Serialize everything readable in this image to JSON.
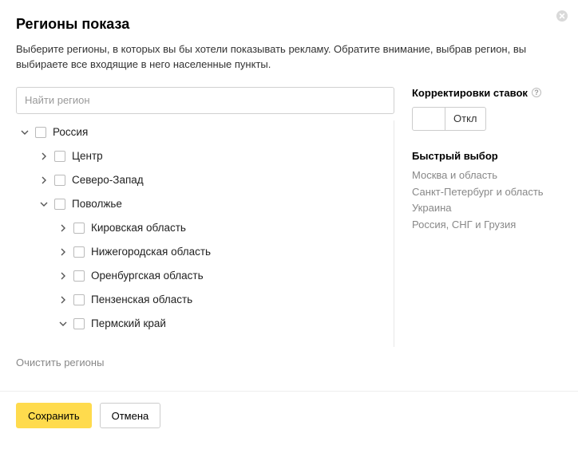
{
  "header": {
    "title": "Регионы показа",
    "description": "Выберите регионы, в которых вы бы хотели показывать рекламу. Обратите внимание, выбрав регион, вы выбираете все входящие в него населенные пункты."
  },
  "search": {
    "placeholder": "Найти регион"
  },
  "tree": [
    {
      "label": "Россия",
      "depth": 0,
      "expanded": true
    },
    {
      "label": "Центр",
      "depth": 1,
      "expanded": false
    },
    {
      "label": "Северо-Запад",
      "depth": 1,
      "expanded": false
    },
    {
      "label": "Поволжье",
      "depth": 1,
      "expanded": true
    },
    {
      "label": "Кировская область",
      "depth": 2,
      "expanded": false
    },
    {
      "label": "Нижегородская область",
      "depth": 2,
      "expanded": false
    },
    {
      "label": "Оренбургская область",
      "depth": 2,
      "expanded": false
    },
    {
      "label": "Пензенская область",
      "depth": 2,
      "expanded": false
    },
    {
      "label": "Пермский край",
      "depth": 2,
      "expanded": true
    }
  ],
  "clear_label": "Очистить регионы",
  "sidebar": {
    "bids_title": "Корректировки ставок",
    "toggle_label": "Откл",
    "quick_title": "Быстрый выбор",
    "quick_links": [
      "Москва и область",
      "Санкт-Петербург и область",
      "Украина",
      "Россия, СНГ и Грузия"
    ]
  },
  "footer": {
    "save": "Сохранить",
    "cancel": "Отмена"
  }
}
